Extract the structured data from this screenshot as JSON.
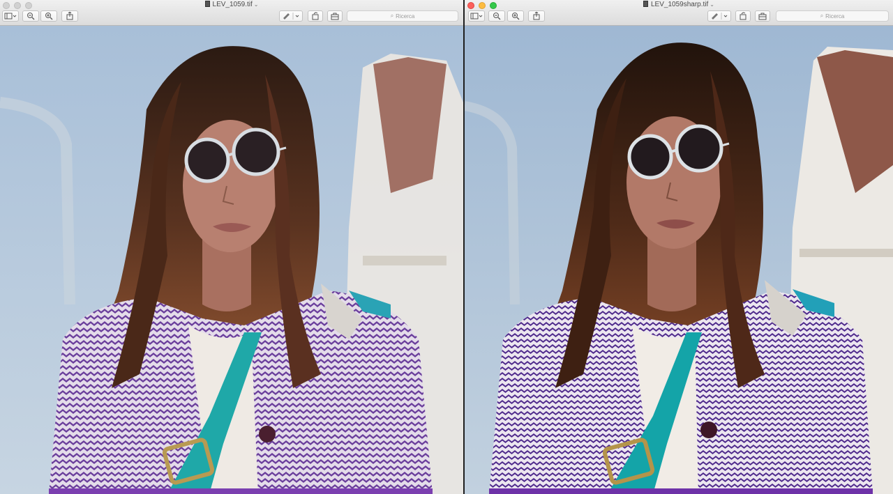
{
  "windows": [
    {
      "title": "LEV_1059.tif",
      "search_placeholder": "Ricerca",
      "state": "inactive"
    },
    {
      "title": "LEV_1059sharp.tif",
      "search_placeholder": "Ricerca",
      "state": "active"
    }
  ],
  "colors": {
    "sky": "#b4c8dc",
    "jacket_purple": "#6a4a9a",
    "strap_teal": "#1fa8a8",
    "hair": "#5a3320"
  }
}
